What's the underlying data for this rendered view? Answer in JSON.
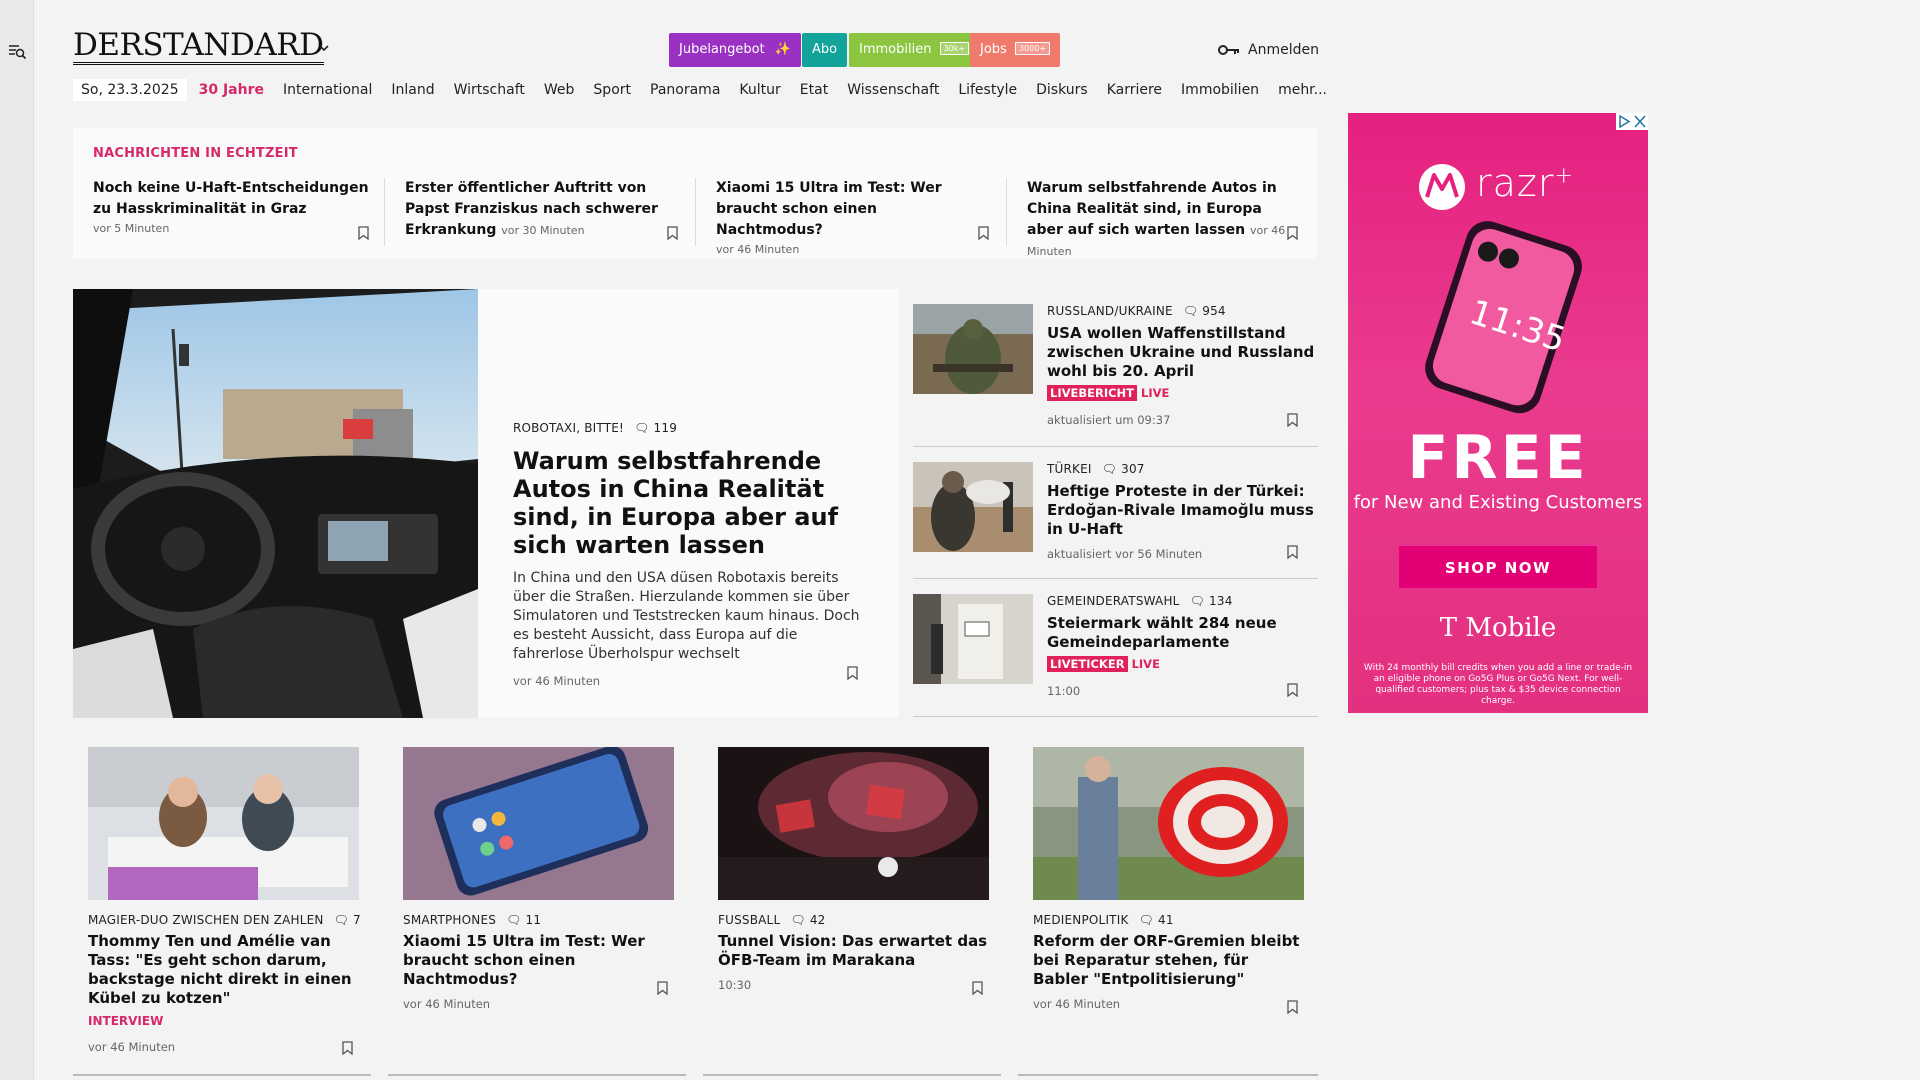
{
  "header": {
    "logo": "DERSTANDARD",
    "pills": [
      {
        "label": "Jubelangebot",
        "color": "#9b31c2",
        "badge": ""
      },
      {
        "label": "Abo",
        "color": "#12a39a",
        "badge": ""
      },
      {
        "label": "Immobilien",
        "color": "#8cc540",
        "badge": "30k+"
      },
      {
        "label": "Jobs",
        "color": "#f07b6d",
        "badge": "3000+"
      }
    ],
    "login_label": "Anmelden"
  },
  "nav": {
    "date": "So, 23.3.2025",
    "highlight": "30 Jahre",
    "items": [
      "International",
      "Inland",
      "Wirtschaft",
      "Web",
      "Sport",
      "Panorama",
      "Kultur",
      "Etat",
      "Wissenschaft",
      "Lifestyle",
      "Diskurs",
      "Karriere",
      "Immobilien",
      "mehr..."
    ]
  },
  "live_news": {
    "title": "NACHRICHTEN IN ECHTZEIT",
    "items": [
      {
        "title": "Noch keine U-Haft-Entscheidungen zu Hasskriminalität in Graz",
        "time": "vor 5 Minuten"
      },
      {
        "title": "Erster öffentlicher Auftritt von Papst Franziskus nach schwerer Erkrankung",
        "time": "vor 30 Minuten"
      },
      {
        "title": "Xiaomi 15 Ultra im Test: Wer braucht schon einen Nachtmodus?",
        "time": "vor 46 Minuten"
      },
      {
        "title": "Warum selbstfahrende Autos in China Realität sind, in Europa aber auf sich warten lassen",
        "time": "vor 46 Minuten"
      }
    ]
  },
  "lead": {
    "kicker": "ROBOTAXI, BITTE!",
    "comments": "119",
    "headline": "Warum selbstfahrende Autos in China Realität sind, in Europa aber auf sich warten lassen",
    "teaser": "In China und den USA düsen Robotaxis bereits über die Straßen. Hierzulande kommen sie über Simulatoren und Teststrecken kaum hinaus. Doch es besteht Aussicht, dass Europa auf die fahrerlose Überholspur wechselt",
    "time": "vor 46 Minuten"
  },
  "side": [
    {
      "kicker": "RUSSLAND/UKRAINE",
      "comments": "954",
      "headline": "USA wollen Waffenstillstand zwischen Ukraine und Russland wohl bis 20. April",
      "tag": "LIVEBERICHT",
      "live": "LIVE",
      "time": "aktualisiert um 09:37"
    },
    {
      "kicker": "TÜRKEI",
      "comments": "307",
      "headline": "Heftige Proteste in der Türkei: Erdoğan-Rivale Imamoğlu muss in U-Haft",
      "tag": "",
      "live": "",
      "time": "aktualisiert vor 56 Minuten"
    },
    {
      "kicker": "GEMEINDERATSWAHL",
      "comments": "134",
      "headline": "Steiermark wählt 284 neue Gemeindeparlamente",
      "tag": "LIVETICKER",
      "live": "LIVE",
      "time": "11:00"
    }
  ],
  "cards": [
    {
      "kicker": "MAGIER-DUO ZWISCHEN DEN ZAHLEN",
      "comments": "7",
      "headline": "Thommy Ten und Amélie van Tass: \"Es geht schon darum, backstage nicht direkt in einen Kübel zu kotzen\"",
      "label": "INTERVIEW",
      "time": "vor 46 Minuten"
    },
    {
      "kicker": "SMARTPHONES",
      "comments": "11",
      "headline": "Xiaomi 15 Ultra im Test: Wer braucht schon einen Nachtmodus?",
      "label": "",
      "time": "vor 46 Minuten"
    },
    {
      "kicker": "FUSSBALL",
      "comments": "42",
      "headline": "Tunnel Vision: Das erwartet das ÖFB-Team im Marakana",
      "label": "",
      "time": "10:30"
    },
    {
      "kicker": "MEDIENPOLITIK",
      "comments": "41",
      "headline": "Reform der ORF-Gremien bleibt bei Reparatur stehen, für Babler \"Entpolitisierung\"",
      "label": "",
      "time": "vor 46 Minuten"
    }
  ],
  "ad": {
    "brand": "razr",
    "brand_plus": "+",
    "phone_time": "11:35",
    "headline": "FREE",
    "sub": "for New and Existing Customers",
    "cta": "SHOP NOW",
    "advertiser": "T Mobile",
    "fine_print": "With 24 monthly bill credits when you add a line or trade-in an eligible phone on Go5G Plus or Go5G Next. For well-qualified customers; plus tax & $35 device connection charge."
  },
  "colors": {
    "accent": "#d6286a",
    "live_tag": "#e0215a",
    "ad_bg": "#e5207f"
  }
}
